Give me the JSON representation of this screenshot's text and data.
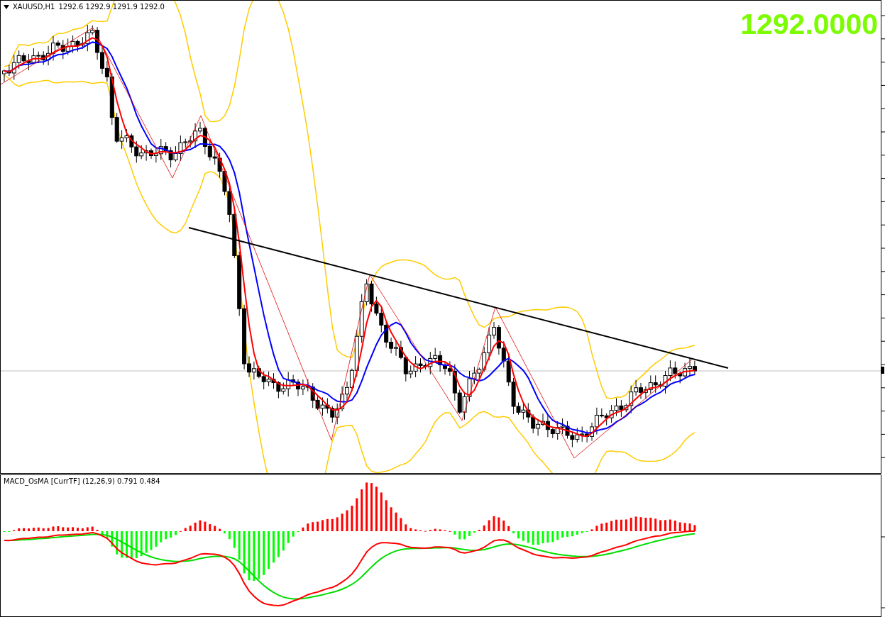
{
  "chart": {
    "symbol": "XAUUSD,H1",
    "ohlc": "1292.6 1292.9 1291.9 1292.0",
    "last_price": "1292.0000"
  },
  "indicator": {
    "label": "MACD_OsMA [CurrTF] (12,26,9) 0.791 0.484"
  }
}
